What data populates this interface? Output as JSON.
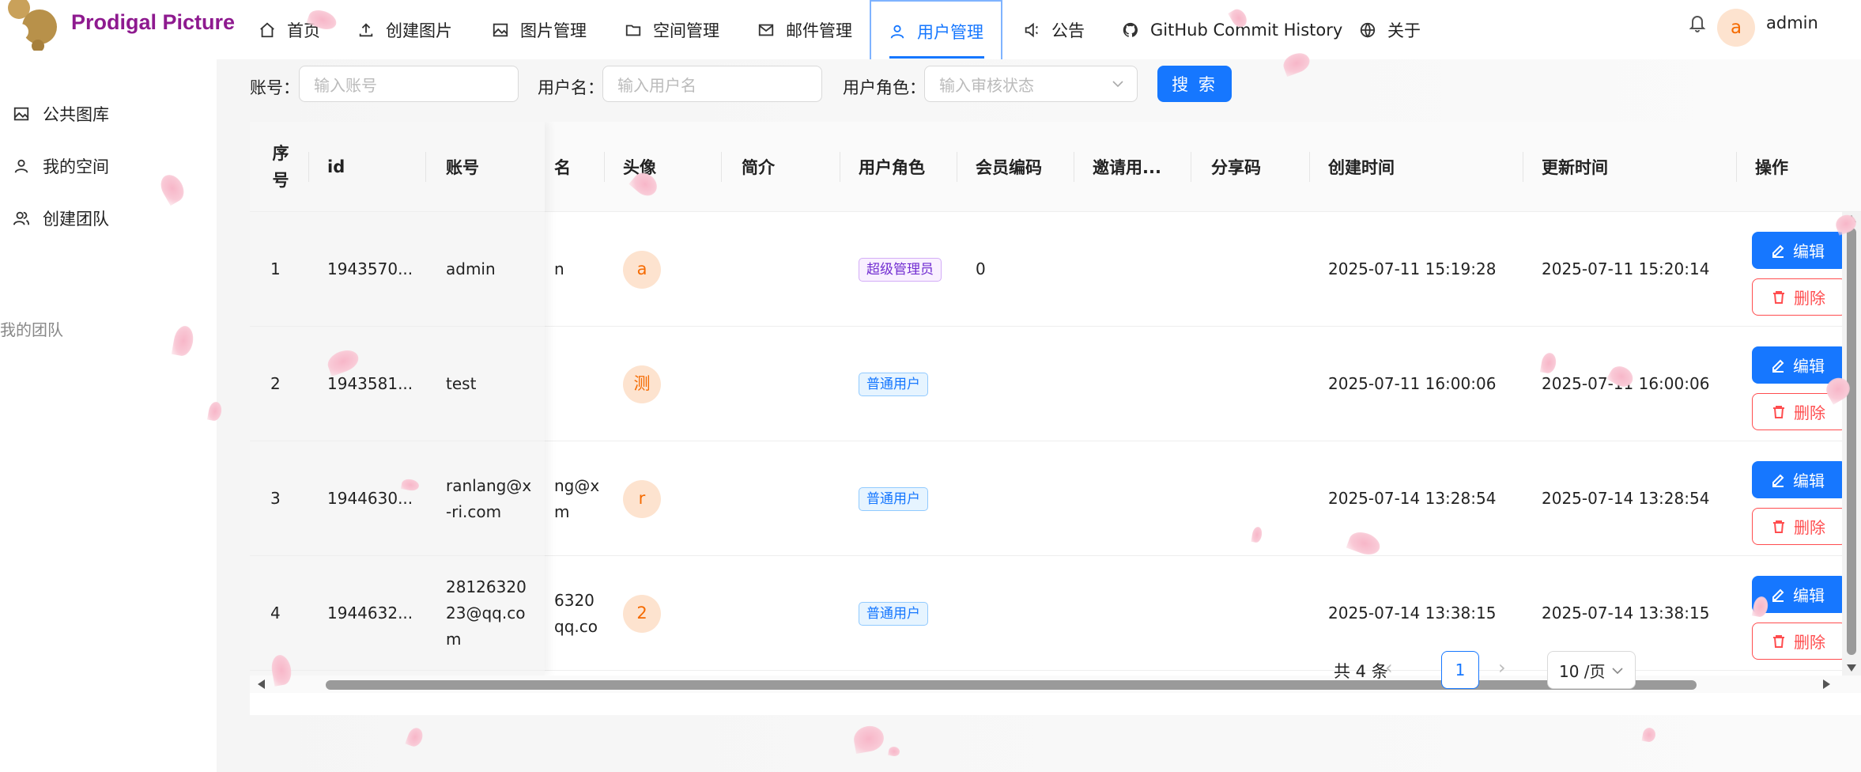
{
  "header": {
    "brand": "Prodigal Picture",
    "nav": [
      {
        "label": "首页",
        "icon": "home-icon"
      },
      {
        "label": "创建图片",
        "icon": "upload-icon"
      },
      {
        "label": "图片管理",
        "icon": "picture-icon"
      },
      {
        "label": "空间管理",
        "icon": "folder-icon"
      },
      {
        "label": "邮件管理",
        "icon": "mail-icon"
      },
      {
        "label": "用户管理",
        "icon": "user-icon",
        "active": true
      },
      {
        "label": "公告",
        "icon": "sound-icon"
      },
      {
        "label": "GitHub Commit History",
        "icon": "github-icon"
      },
      {
        "label": "关于",
        "icon": "globe-icon"
      }
    ],
    "user": {
      "avatar_letter": "a",
      "name": "admin"
    }
  },
  "sidebar": {
    "items": [
      {
        "label": "公共图库",
        "icon": "picture-icon"
      },
      {
        "label": "我的空间",
        "icon": "user-icon"
      },
      {
        "label": "创建团队",
        "icon": "team-icon"
      }
    ],
    "group_label": "我的团队"
  },
  "search": {
    "account_label": "账号：",
    "account_placeholder": "输入账号",
    "username_label": "用户名：",
    "username_placeholder": "输入用户名",
    "role_label": "用户角色：",
    "role_placeholder": "输入审核状态",
    "button_label": "搜 索"
  },
  "table": {
    "columns": [
      "序号",
      "id",
      "账号",
      "名",
      "头像",
      "简介",
      "用户角色",
      "会员编码",
      "邀请用...",
      "分享码",
      "创建时间",
      "更新时间",
      "操作"
    ],
    "rows": [
      {
        "index": "1",
        "id": "1943570...",
        "account": "admin",
        "name": "n",
        "avatar": "a",
        "intro": "",
        "role": "超级管理员",
        "role_type": "super",
        "vip_code": "0",
        "invite": "",
        "share": "",
        "created": "2025-07-11 15:19:28",
        "updated": "2025-07-11 15:20:14"
      },
      {
        "index": "2",
        "id": "1943581...",
        "account": "test",
        "name": "",
        "avatar": "测",
        "intro": "",
        "role": "普通用户",
        "role_type": "normal",
        "vip_code": "",
        "invite": "",
        "share": "",
        "created": "2025-07-11 16:00:06",
        "updated": "2025-07-11 16:00:06"
      },
      {
        "index": "3",
        "id": "1944630...",
        "account": "ranlang@x\n-ri.com",
        "name": "ng@x\nm",
        "avatar": "r",
        "intro": "",
        "role": "普通用户",
        "role_type": "normal",
        "vip_code": "",
        "invite": "",
        "share": "",
        "created": "2025-07-14 13:28:54",
        "updated": "2025-07-14 13:28:54"
      },
      {
        "index": "4",
        "id": "1944632...",
        "account": "28126320\n23@qq.co\nm",
        "name": "6320\nqq.co",
        "avatar": "2",
        "intro": "",
        "role": "普通用户",
        "role_type": "normal",
        "vip_code": "",
        "invite": "",
        "share": "",
        "created": "2025-07-14 13:38:15",
        "updated": "2025-07-14 13:38:15"
      }
    ],
    "edit_label": "编辑",
    "delete_label": "删除"
  },
  "pagination": {
    "total": "共 4 条",
    "current_page": "1",
    "page_size": "10 /页"
  }
}
